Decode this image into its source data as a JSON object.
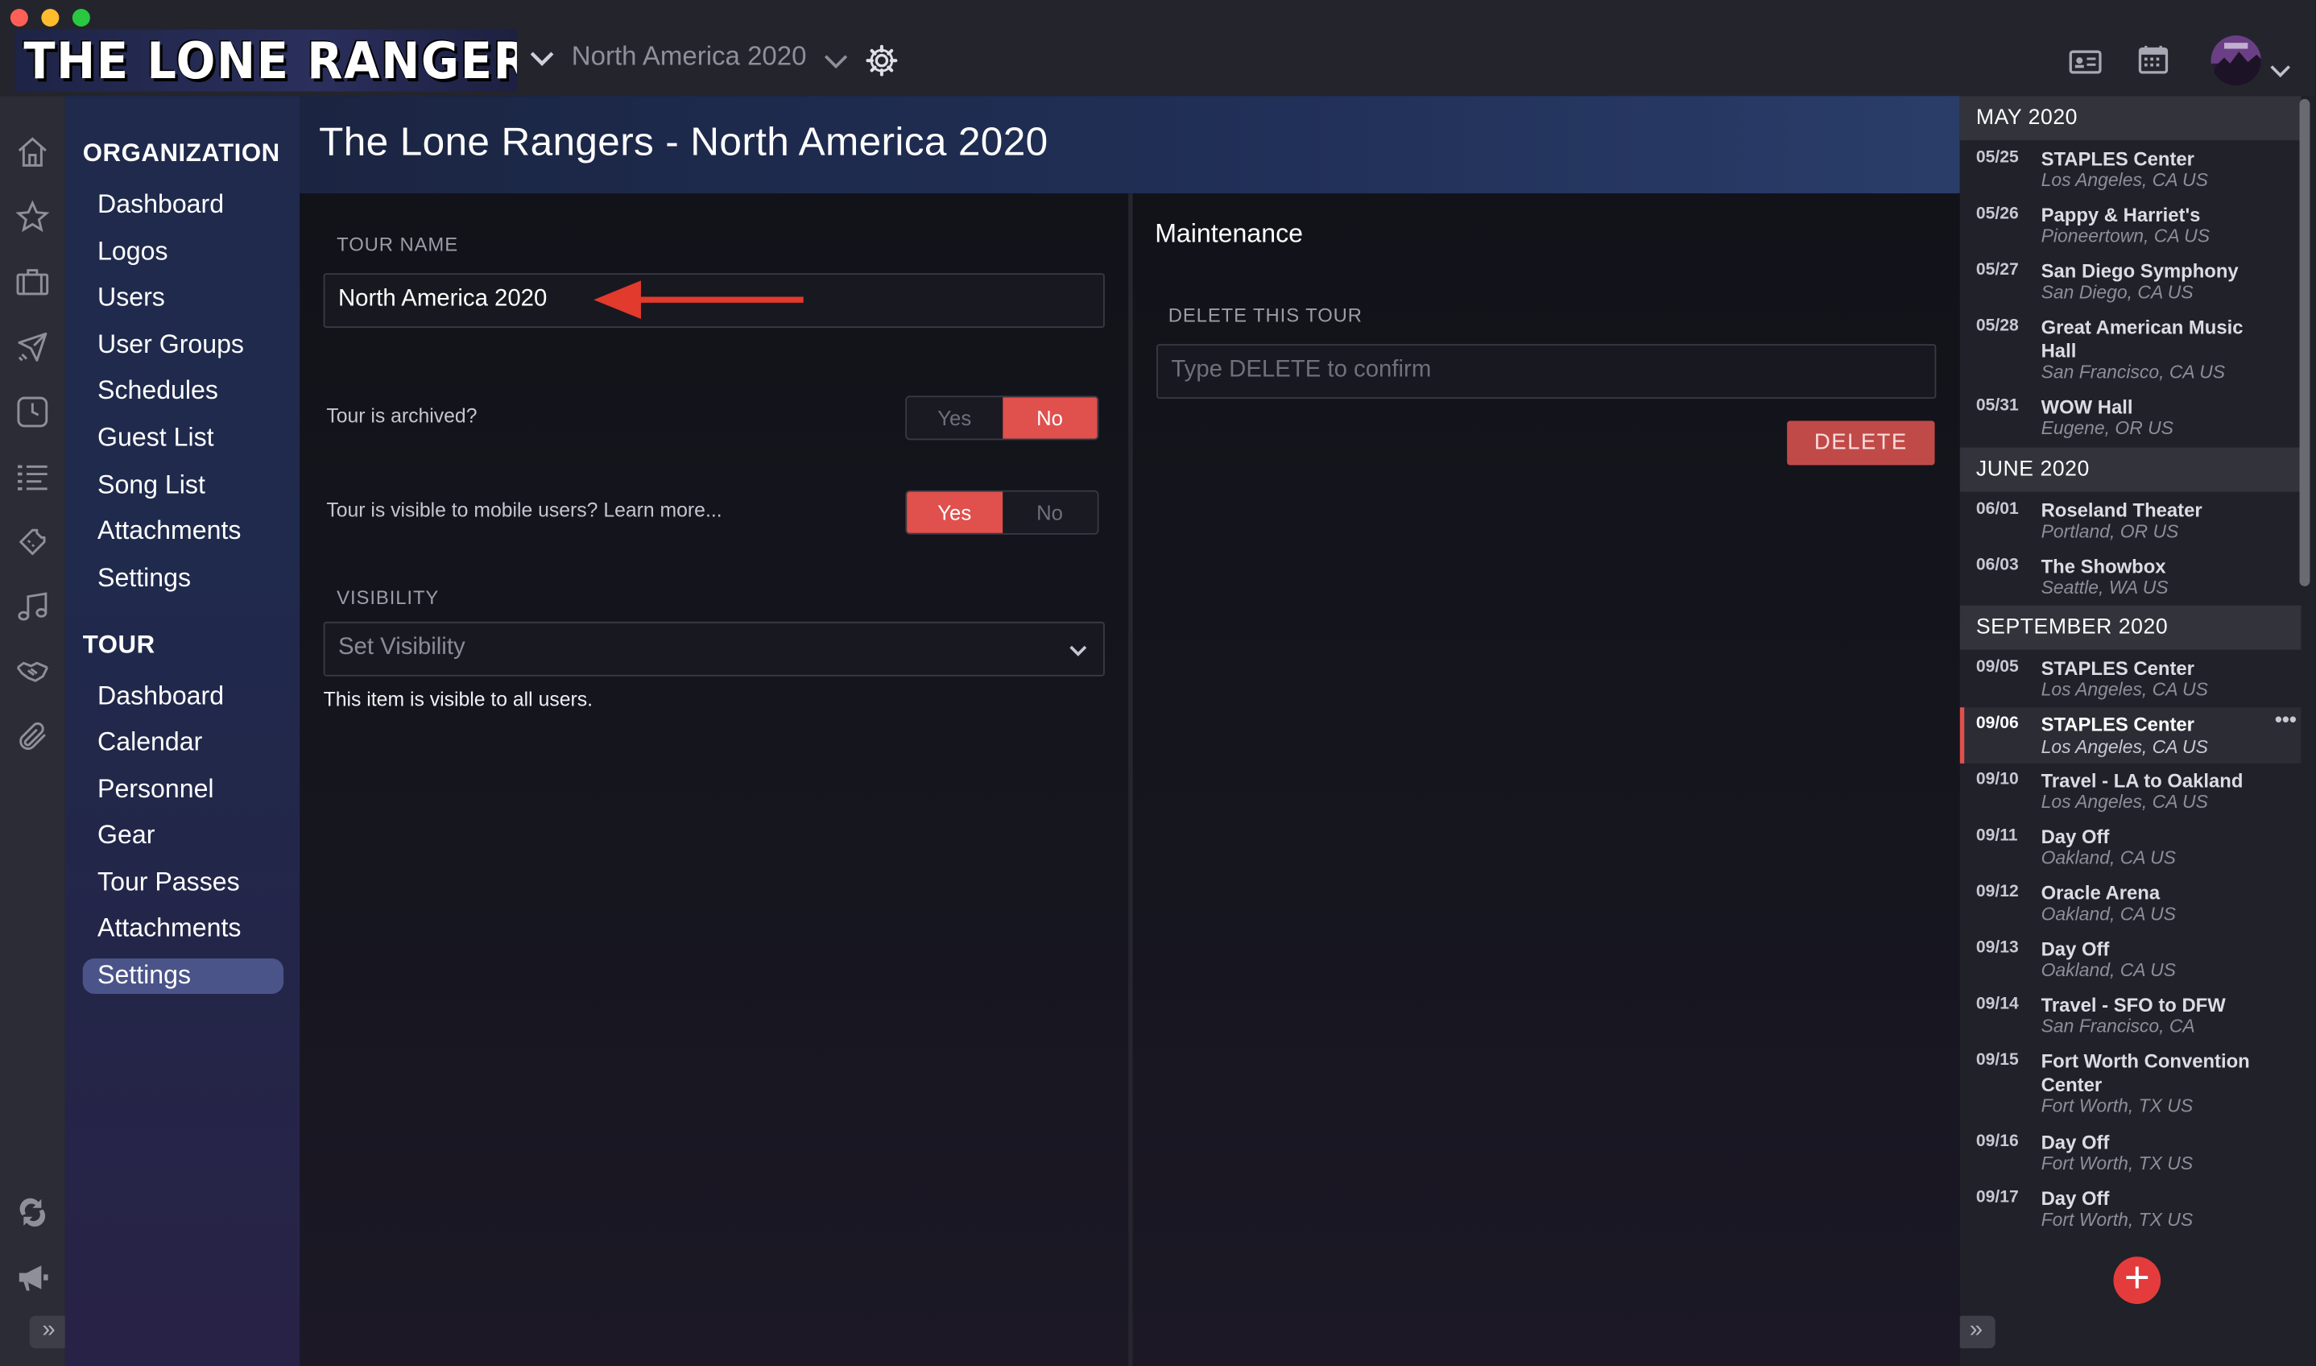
{
  "app": {
    "logo_text": "THE LONE RANGERS",
    "tour_selector": "North America 2020"
  },
  "sidebar": {
    "organization_title": "ORGANIZATION",
    "organization_items": [
      "Dashboard",
      "Logos",
      "Users",
      "User Groups",
      "Schedules",
      "Guest List",
      "Song List",
      "Attachments",
      "Settings"
    ],
    "tour_title": "TOUR",
    "tour_items": [
      "Dashboard",
      "Calendar",
      "Personnel",
      "Gear",
      "Tour Passes",
      "Attachments",
      "Settings"
    ],
    "active_item": "Settings"
  },
  "page": {
    "title": "The Lone Rangers - North America 2020"
  },
  "settings": {
    "tour_name_label": "TOUR NAME",
    "tour_name_value": "North America 2020",
    "archived_label": "Tour is archived?",
    "archived_options": [
      "Yes",
      "No"
    ],
    "archived_selected": "No",
    "mobile_label": "Tour is visible to mobile users? Learn more...",
    "mobile_options": [
      "Yes",
      "No"
    ],
    "mobile_selected": "Yes",
    "visibility_label": "VISIBILITY",
    "visibility_placeholder": "Set Visibility",
    "visibility_note": "This item is visible to all users."
  },
  "maintenance": {
    "title": "Maintenance",
    "delete_label": "DELETE THIS TOUR",
    "delete_placeholder": "Type DELETE to confirm",
    "delete_button": "DELETE"
  },
  "schedule": {
    "months": [
      {
        "label": "MAY 2020",
        "events": [
          {
            "date": "05/25",
            "name": "STAPLES Center",
            "location": "Los Angeles, CA US"
          },
          {
            "date": "05/26",
            "name": "Pappy & Harriet's",
            "location": "Pioneertown, CA US"
          },
          {
            "date": "05/27",
            "name": "San Diego Symphony",
            "location": "San Diego, CA US"
          },
          {
            "date": "05/28",
            "name": "Great American Music Hall",
            "location": "San Francisco, CA US"
          },
          {
            "date": "05/31",
            "name": "WOW Hall",
            "location": "Eugene, OR US"
          }
        ]
      },
      {
        "label": "JUNE 2020",
        "events": [
          {
            "date": "06/01",
            "name": "Roseland Theater",
            "location": "Portland, OR US"
          },
          {
            "date": "06/03",
            "name": "The Showbox",
            "location": "Seattle, WA US"
          }
        ]
      },
      {
        "label": "SEPTEMBER 2020",
        "events": [
          {
            "date": "09/05",
            "name": "STAPLES Center",
            "location": "Los Angeles, CA US"
          },
          {
            "date": "09/06",
            "name": "STAPLES Center",
            "location": "Los Angeles, CA US",
            "selected": true
          },
          {
            "date": "09/10",
            "name": "Travel - LA to Oakland",
            "location": "Los Angeles, CA US"
          },
          {
            "date": "09/11",
            "name": "Day Off",
            "location": "Oakland, CA US"
          },
          {
            "date": "09/12",
            "name": "Oracle Arena",
            "location": "Oakland, CA US"
          },
          {
            "date": "09/13",
            "name": "Day Off",
            "location": "Oakland, CA US"
          },
          {
            "date": "09/14",
            "name": "Travel - SFO to DFW",
            "location": "San Francisco, CA"
          },
          {
            "date": "09/15",
            "name": "Fort Worth Convention Center",
            "location": "Fort Worth, TX US"
          },
          {
            "date": "09/16",
            "name": "Day Off",
            "location": "Fort Worth, TX US"
          },
          {
            "date": "09/17",
            "name": "Day Off",
            "location": "Fort Worth, TX US"
          }
        ]
      }
    ]
  },
  "colors": {
    "accent": "#e0504c",
    "nav_active": "#4a5489",
    "window_bg": "#24242c"
  },
  "icons": [
    "home-icon",
    "star-icon",
    "briefcase-icon",
    "plane-icon",
    "clock-icon",
    "list-icon",
    "ticket-icon",
    "music-icon",
    "handshake-icon",
    "paperclip-icon",
    "sync-icon",
    "megaphone-icon",
    "expand-icon",
    "gear-icon",
    "contact-card-icon",
    "calendar-icon",
    "avatar",
    "add-icon"
  ]
}
